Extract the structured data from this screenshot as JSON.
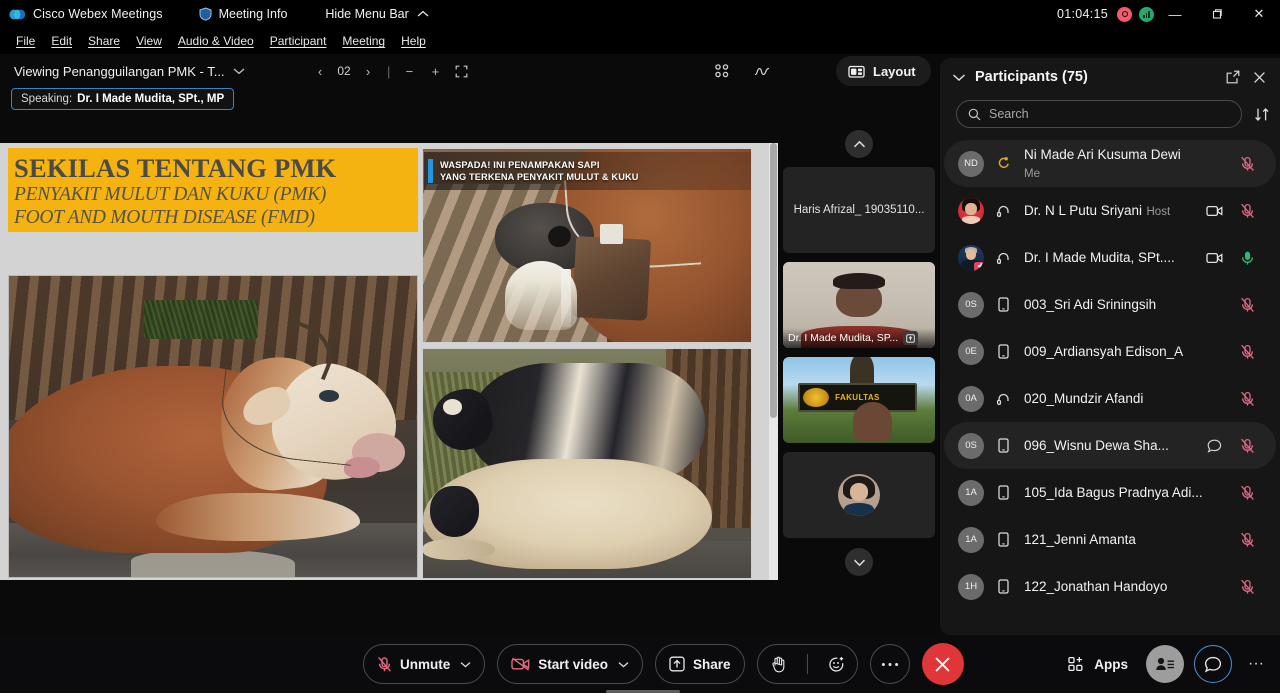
{
  "titlebar": {
    "app_name": "Cisco Webex Meetings",
    "meeting_info": "Meeting Info",
    "hide_menu_bar": "Hide Menu Bar",
    "timer": "01:04:15",
    "minimize": "—",
    "restore": "❐",
    "close": "✕"
  },
  "menubar": {
    "items": [
      {
        "label": "File"
      },
      {
        "label": "Edit"
      },
      {
        "label": "Share"
      },
      {
        "label": "View"
      },
      {
        "label": "Audio & Video"
      },
      {
        "label": "Participant"
      },
      {
        "label": "Meeting"
      },
      {
        "label": "Help"
      }
    ]
  },
  "stage": {
    "viewing_title": "Viewing Penangguilangan PMK - T...",
    "page_number": "02",
    "prev": "‹",
    "next": "›",
    "zoom_out": "−",
    "zoom_in": "+",
    "layout_label": "Layout",
    "speaking_label": "Speaking:",
    "speaking_name": "Dr. I Made Mudita, SPt., MP"
  },
  "slide": {
    "title_main": "SEKILAS TENTANG PMK",
    "title_sub1": "PENYAKIT MULUT DAN KUKU (PMK)",
    "title_sub2": "FOOT AND MOUTH DISEASE (FMD)",
    "caption_line1": "WASPADA! INI PENAMPAKAN SAPI",
    "caption_line2": "YANG TERKENA PENYAKIT MULUT & KUKU"
  },
  "filmstrip": {
    "tiles": [
      {
        "name": "Haris Afrizal_ 19035110...",
        "has_video": false,
        "active": false
      },
      {
        "name": "Dr. I Made Mudita, SP...",
        "has_video": true,
        "active": true
      },
      {
        "name": "",
        "has_video": true,
        "active": false
      },
      {
        "name": "",
        "has_video": false,
        "active": false
      }
    ]
  },
  "panel": {
    "title": "Participants (75)",
    "search_placeholder": "Search",
    "search_value": "",
    "participants": [
      {
        "initials": "ND",
        "name": "Ni Made Ari Kusuma Dewi",
        "sub": "Me",
        "device": "handraise",
        "cam": false,
        "chat": false,
        "mic": "off",
        "highlight": true,
        "avatar": "initials"
      },
      {
        "initials": "",
        "name": "Dr. N L Putu Sriyani",
        "sub": "Host",
        "device": "headset",
        "cam": true,
        "chat": false,
        "mic": "off",
        "highlight": false,
        "avatar": "photo1"
      },
      {
        "initials": "",
        "name": "Dr. I Made Mudita, SPt....",
        "sub": "",
        "device": "headset",
        "cam": true,
        "chat": false,
        "mic": "on",
        "highlight": false,
        "avatar": "photo2"
      },
      {
        "initials": "0S",
        "name": "003_Sri Adi Sriningsih",
        "sub": "",
        "device": "mobile",
        "cam": false,
        "chat": false,
        "mic": "off",
        "highlight": false,
        "avatar": "initials"
      },
      {
        "initials": "0E",
        "name": "009_Ardiansyah Edison_A",
        "sub": "",
        "device": "mobile",
        "cam": false,
        "chat": false,
        "mic": "off",
        "highlight": false,
        "avatar": "initials"
      },
      {
        "initials": "0A",
        "name": "020_Mundzir Afandi",
        "sub": "",
        "device": "headset",
        "cam": false,
        "chat": false,
        "mic": "off",
        "highlight": false,
        "avatar": "initials"
      },
      {
        "initials": "0S",
        "name": "096_Wisnu Dewa Sha...",
        "sub": "",
        "device": "mobile",
        "cam": false,
        "chat": true,
        "mic": "off",
        "highlight": true,
        "avatar": "initials"
      },
      {
        "initials": "1A",
        "name": "105_Ida Bagus Pradnya Adi...",
        "sub": "",
        "device": "mobile",
        "cam": false,
        "chat": false,
        "mic": "off",
        "highlight": false,
        "avatar": "initials"
      },
      {
        "initials": "1A",
        "name": "121_Jenni Amanta",
        "sub": "",
        "device": "mobile",
        "cam": false,
        "chat": false,
        "mic": "off",
        "highlight": false,
        "avatar": "initials"
      },
      {
        "initials": "1H",
        "name": "122_Jonathan Handoyo",
        "sub": "",
        "device": "mobile",
        "cam": false,
        "chat": false,
        "mic": "off",
        "highlight": false,
        "avatar": "initials"
      }
    ]
  },
  "bottombar": {
    "unmute_label": "Unmute",
    "start_video_label": "Start video",
    "share_label": "Share",
    "apps_label": "Apps",
    "more_label": "···",
    "end_label": "✕"
  },
  "colors": {
    "accent_blue": "#53a7e8",
    "mic_off_red": "#e06a84",
    "mic_on_green": "#28b976",
    "end_red": "#e0363a",
    "slide_yellow": "#f5b312",
    "recording_red": "#f05c6e",
    "network_green": "#26a96a"
  }
}
